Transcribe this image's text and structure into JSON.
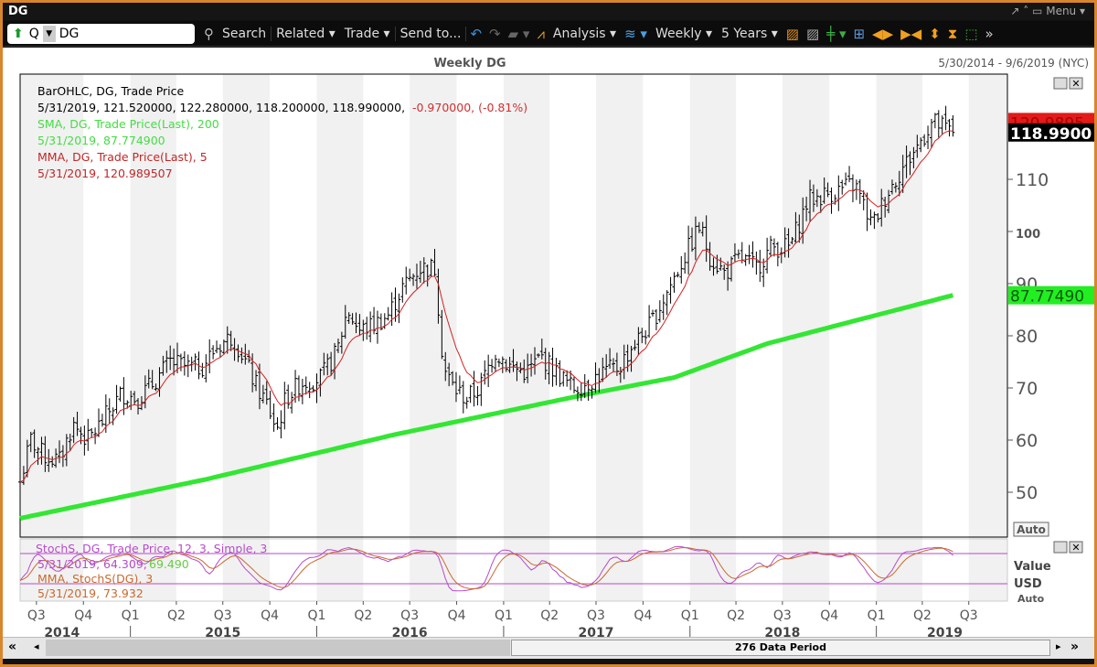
{
  "window": {
    "title": "DG",
    "controls": "↗ ˄ ▭ Menu ▾"
  },
  "toolbar": {
    "direction_icon": "up-arrow",
    "security_type": "Q",
    "ticker": "DG",
    "search": "Search",
    "related": "Related ▾",
    "trade": "Trade ▾",
    "send_to": "Send to...",
    "analysis": "Analysis ▾",
    "periodicity": "Weekly ▾",
    "range": "5 Years ▾"
  },
  "chart_header": {
    "title": "Weekly DG",
    "date_range": "5/30/2014 - 9/6/2019 (NYC)"
  },
  "legend": {
    "bar_label": "BarOHLC, DG, Trade Price",
    "bar_values": "5/31/2019, 121.520000, 122.280000, 118.200000, 118.990000,",
    "bar_change": "-0.970000, (-0.81%)",
    "sma_label": "SMA, DG, Trade Price(Last),  200",
    "sma_value": "5/31/2019, 87.774900",
    "mma_label": "MMA, DG, Trade Price(Last),  5",
    "mma_value": "5/31/2019, 120.989507"
  },
  "stoch_legend": {
    "label": "StochS, DG, Trade Price,  12, 3, Simple, 3",
    "values_a": "5/31/2019, 64.309,",
    "values_b": "69.490",
    "mma_label": "MMA, StochS(DG),  3",
    "mma_value": "5/31/2019, 73.932"
  },
  "price_labels": {
    "mma": "120.9895",
    "last": "118.9900",
    "sma": "87.77490"
  },
  "axis": {
    "auto": "Auto",
    "value": "Value",
    "currency": "USD",
    "auto2": "Auto"
  },
  "scroll": {
    "label": "276 Data Period"
  },
  "colors": {
    "mma": "#d42020",
    "sma": "#33e633",
    "stoch": "#b64cc9",
    "bars": "#000000"
  },
  "chart_data": {
    "type": "ohlc-bar",
    "title": "Weekly DG",
    "ylim": [
      45,
      123
    ],
    "yticks": [
      50,
      60,
      70,
      80,
      90,
      100,
      110
    ],
    "quarter_ticks": [
      [
        "2014-07-01",
        "Q3"
      ],
      [
        "2014-10-01",
        "Q4"
      ],
      [
        "2015-01-01",
        "Q1"
      ],
      [
        "2015-04-01",
        "Q2"
      ],
      [
        "2015-07-01",
        "Q3"
      ],
      [
        "2015-10-01",
        "Q4"
      ],
      [
        "2016-01-01",
        "Q1"
      ],
      [
        "2016-04-01",
        "Q2"
      ],
      [
        "2016-07-01",
        "Q3"
      ],
      [
        "2016-10-01",
        "Q4"
      ],
      [
        "2017-01-01",
        "Q1"
      ],
      [
        "2017-04-01",
        "Q2"
      ],
      [
        "2017-07-01",
        "Q3"
      ],
      [
        "2017-10-01",
        "Q4"
      ],
      [
        "2018-01-01",
        "Q1"
      ],
      [
        "2018-04-01",
        "Q2"
      ],
      [
        "2018-07-01",
        "Q3"
      ],
      [
        "2018-10-01",
        "Q4"
      ],
      [
        "2019-01-01",
        "Q1"
      ],
      [
        "2019-04-01",
        "Q2"
      ],
      [
        "2019-07-01",
        "Q3"
      ]
    ],
    "years": [
      [
        "2014-08-20",
        "2014"
      ],
      [
        "2015-07-01",
        "2015"
      ],
      [
        "2016-07-01",
        "2016"
      ],
      [
        "2017-07-01",
        "2017"
      ],
      [
        "2018-07-01",
        "2018"
      ],
      [
        "2019-05-15",
        "2019"
      ]
    ],
    "start": "2014-05-30",
    "end": "2019-09-06",
    "last_bar": {
      "date": "5/31/2019",
      "open": 121.52,
      "high": 122.28,
      "low": 118.2,
      "close": 118.99
    },
    "monthly_close": [
      [
        "2014-05-30",
        52
      ],
      [
        "2014-06-20",
        60
      ],
      [
        "2014-07-15",
        57
      ],
      [
        "2014-08-15",
        56
      ],
      [
        "2014-09-10",
        63
      ],
      [
        "2014-10-10",
        60
      ],
      [
        "2014-11-10",
        64
      ],
      [
        "2014-12-15",
        69
      ],
      [
        "2015-01-15",
        68
      ],
      [
        "2015-02-15",
        71
      ],
      [
        "2015-03-20",
        75
      ],
      [
        "2015-04-20",
        74
      ],
      [
        "2015-05-20",
        74
      ],
      [
        "2015-06-20",
        78
      ],
      [
        "2015-07-20",
        80
      ],
      [
        "2015-08-10",
        76
      ],
      [
        "2015-09-01",
        71
      ],
      [
        "2015-09-25",
        67
      ],
      [
        "2015-10-15",
        62
      ],
      [
        "2015-11-01",
        68
      ],
      [
        "2015-12-01",
        71
      ],
      [
        "2016-01-10",
        72
      ],
      [
        "2016-02-10",
        77
      ],
      [
        "2016-03-01",
        85
      ],
      [
        "2016-03-25",
        81
      ],
      [
        "2016-04-20",
        82
      ],
      [
        "2016-05-20",
        84
      ],
      [
        "2016-06-15",
        89
      ],
      [
        "2016-07-20",
        93
      ],
      [
        "2016-08-20",
        93
      ],
      [
        "2016-09-05",
        74
      ],
      [
        "2016-09-25",
        70
      ],
      [
        "2016-10-20",
        68
      ],
      [
        "2016-11-15",
        70
      ],
      [
        "2016-12-15",
        77
      ],
      [
        "2017-01-15",
        74
      ],
      [
        "2017-02-15",
        73
      ],
      [
        "2017-03-15",
        76
      ],
      [
        "2017-04-15",
        73
      ],
      [
        "2017-05-15",
        70
      ],
      [
        "2017-06-15",
        71
      ],
      [
        "2017-07-15",
        73
      ],
      [
        "2017-08-15",
        74
      ],
      [
        "2017-09-10",
        78
      ],
      [
        "2017-10-15",
        82
      ],
      [
        "2017-11-15",
        88
      ],
      [
        "2017-12-15",
        94
      ],
      [
        "2018-01-20",
        101
      ],
      [
        "2018-02-10",
        95
      ],
      [
        "2018-03-10",
        92
      ],
      [
        "2018-04-10",
        95
      ],
      [
        "2018-05-10",
        93
      ],
      [
        "2018-06-10",
        97
      ],
      [
        "2018-07-15",
        97
      ],
      [
        "2018-08-20",
        106
      ],
      [
        "2018-09-20",
        107
      ],
      [
        "2018-10-20",
        108
      ],
      [
        "2018-11-20",
        109
      ],
      [
        "2018-12-24",
        101
      ],
      [
        "2019-01-20",
        107
      ],
      [
        "2019-02-20",
        112
      ],
      [
        "2019-03-20",
        116
      ],
      [
        "2019-04-20",
        121
      ],
      [
        "2019-05-31",
        119
      ]
    ],
    "sma200": [
      [
        "2014-05-30",
        45
      ],
      [
        "2015-05-30",
        52.5
      ],
      [
        "2016-05-30",
        61
      ],
      [
        "2017-05-30",
        68.5
      ],
      [
        "2017-12-01",
        72
      ],
      [
        "2018-06-01",
        78.5
      ],
      [
        "2019-05-31",
        87.7749
      ]
    ]
  }
}
